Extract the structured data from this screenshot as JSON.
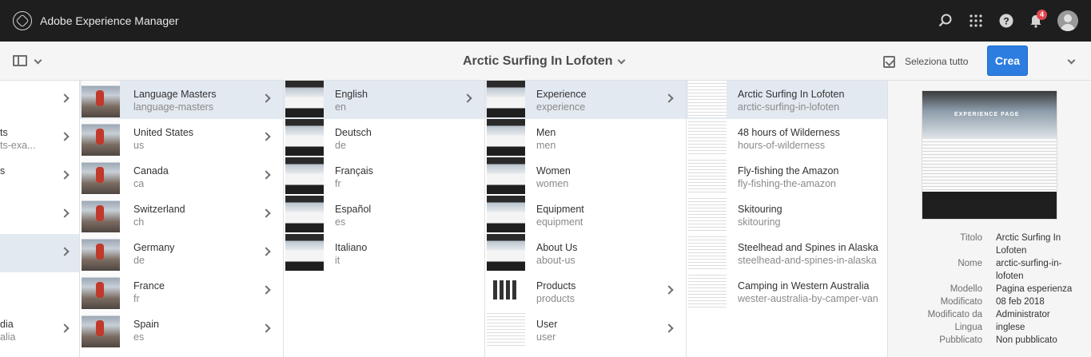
{
  "app": {
    "title": "Adobe Experience Manager",
    "notifications_count": "4"
  },
  "toolbar": {
    "page_title": "Arctic Surfing In Lofoten",
    "select_all": "Seleziona tutto",
    "create": "Crea"
  },
  "col0": [
    {
      "name": "",
      "sub": ""
    },
    {
      "name": "ts",
      "sub": "ts-exa..."
    },
    {
      "name": "s",
      "sub": ""
    },
    {
      "name": "",
      "sub": ""
    },
    {
      "name": "",
      "sub": ""
    },
    {
      "name": "",
      "sub": ""
    },
    {
      "name": "dia",
      "sub": "alia"
    }
  ],
  "col1": [
    {
      "name": "Language Masters",
      "sub": "language-masters"
    },
    {
      "name": "United States",
      "sub": "us"
    },
    {
      "name": "Canada",
      "sub": "ca"
    },
    {
      "name": "Switzerland",
      "sub": "ch"
    },
    {
      "name": "Germany",
      "sub": "de"
    },
    {
      "name": "France",
      "sub": "fr"
    },
    {
      "name": "Spain",
      "sub": "es"
    }
  ],
  "col2": [
    {
      "name": "English",
      "sub": "en"
    },
    {
      "name": "Deutsch",
      "sub": "de"
    },
    {
      "name": "Français",
      "sub": "fr"
    },
    {
      "name": "Español",
      "sub": "es"
    },
    {
      "name": "Italiano",
      "sub": "it"
    }
  ],
  "col3": [
    {
      "name": "Experience",
      "sub": "experience"
    },
    {
      "name": "Men",
      "sub": "men"
    },
    {
      "name": "Women",
      "sub": "women"
    },
    {
      "name": "Equipment",
      "sub": "equipment"
    },
    {
      "name": "About Us",
      "sub": "about-us"
    },
    {
      "name": "Products",
      "sub": "products"
    },
    {
      "name": "User",
      "sub": "user"
    }
  ],
  "col4": [
    {
      "name": "Arctic Surfing In Lofoten",
      "sub": "arctic-surfing-in-lofoten"
    },
    {
      "name": "48 hours of Wilderness",
      "sub": "hours-of-wilderness"
    },
    {
      "name": "Fly-fishing the Amazon",
      "sub": "fly-fishing-the-amazon"
    },
    {
      "name": "Skitouring",
      "sub": "skitouring"
    },
    {
      "name": "Steelhead and Spines in Alaska",
      "sub": "steelhead-and-spines-in-alaska"
    },
    {
      "name": "Camping in Western Australia",
      "sub": "wester-australia-by-camper-van"
    }
  ],
  "meta": {
    "preview_text": "EXPERIENCE PAGE",
    "titolo_label": "Titolo",
    "titolo_value": "Arctic Surfing In Lofoten",
    "nome_label": "Nome",
    "nome_value": "arctic-surfing-in-lofoten",
    "modello_label": "Modello",
    "modello_value": "Pagina esperienza",
    "modificato_label": "Modificato",
    "modificato_value": "08 feb 2018",
    "modificato_da_label": "Modificato da",
    "modificato_da_value": "Administrator",
    "lingua_label": "Lingua",
    "lingua_value": "inglese",
    "pubblicato_label": "Pubblicato",
    "pubblicato_value": "Non pubblicato"
  }
}
